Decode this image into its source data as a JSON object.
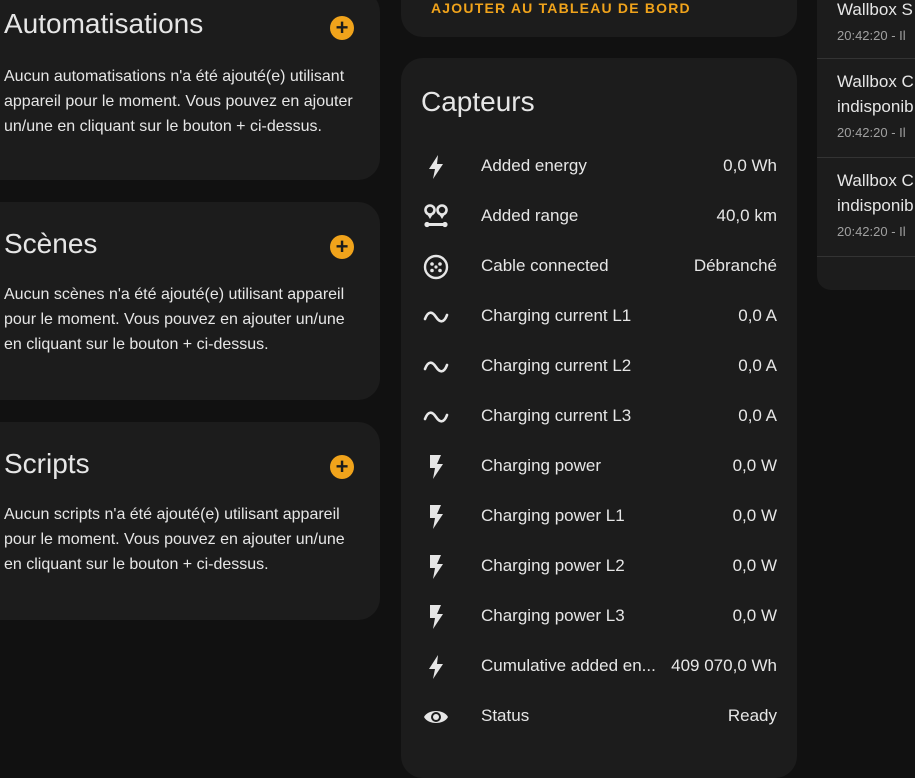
{
  "automations": {
    "title": "Automatisations",
    "description": "Aucun automatisations n'a été ajouté(e) utilisant appareil pour le moment. Vous pouvez en ajouter un/une en cliquant sur le bouton + ci-dessus."
  },
  "scenes": {
    "title": "Scènes",
    "description": "Aucun scènes n'a été ajouté(e) utilisant appareil pour le moment. Vous pouvez en ajouter un/une en cliquant sur le bouton + ci-dessus."
  },
  "scripts": {
    "title": "Scripts",
    "description": "Aucun scripts n'a été ajouté(e) utilisant appareil pour le moment. Vous pouvez en ajouter un/une en cliquant sur le bouton + ci-dessus."
  },
  "add_icon_glyph": "+",
  "dashboard_link": "AJOUTER AU TABLEAU DE BORD",
  "sensors": {
    "title": "Capteurs",
    "rows": [
      {
        "icon": "flash-icon",
        "name": "Added energy",
        "value": "0,0 Wh"
      },
      {
        "icon": "map-marker-distance-icon",
        "name": "Added range",
        "value": "40,0 km"
      },
      {
        "icon": "ev-plug-icon",
        "name": "Cable connected",
        "value": "Débranché"
      },
      {
        "icon": "sine-wave-icon",
        "name": "Charging current L1",
        "value": "0,0 A"
      },
      {
        "icon": "sine-wave-icon",
        "name": "Charging current L2",
        "value": "0,0 A"
      },
      {
        "icon": "sine-wave-icon",
        "name": "Charging current L3",
        "value": "0,0 A"
      },
      {
        "icon": "lightning-bolt-icon",
        "name": "Charging power",
        "value": "0,0 W"
      },
      {
        "icon": "lightning-bolt-icon",
        "name": "Charging power L1",
        "value": "0,0 W"
      },
      {
        "icon": "lightning-bolt-icon",
        "name": "Charging power L2",
        "value": "0,0 W"
      },
      {
        "icon": "lightning-bolt-icon",
        "name": "Charging power L3",
        "value": "0,0 W"
      },
      {
        "icon": "flash-icon",
        "name": "Cumulative added en...",
        "value": "409 070,0 Wh"
      },
      {
        "icon": "eye-icon",
        "name": "Status",
        "value": "Ready"
      }
    ]
  },
  "logbook": {
    "entries": [
      {
        "title": "Wallbox S",
        "time": "20:42:20 - Il"
      },
      {
        "title": "Wallbox C",
        "title2": "indisponib",
        "time": "20:42:20 - Il"
      },
      {
        "title": "Wallbox C",
        "title2": "indisponib",
        "time": "20:42:20 - Il"
      }
    ]
  },
  "colors": {
    "accent": "#f0a31b",
    "background": "#111111",
    "card": "#1c1c1c",
    "text": "#e1e1e1"
  }
}
